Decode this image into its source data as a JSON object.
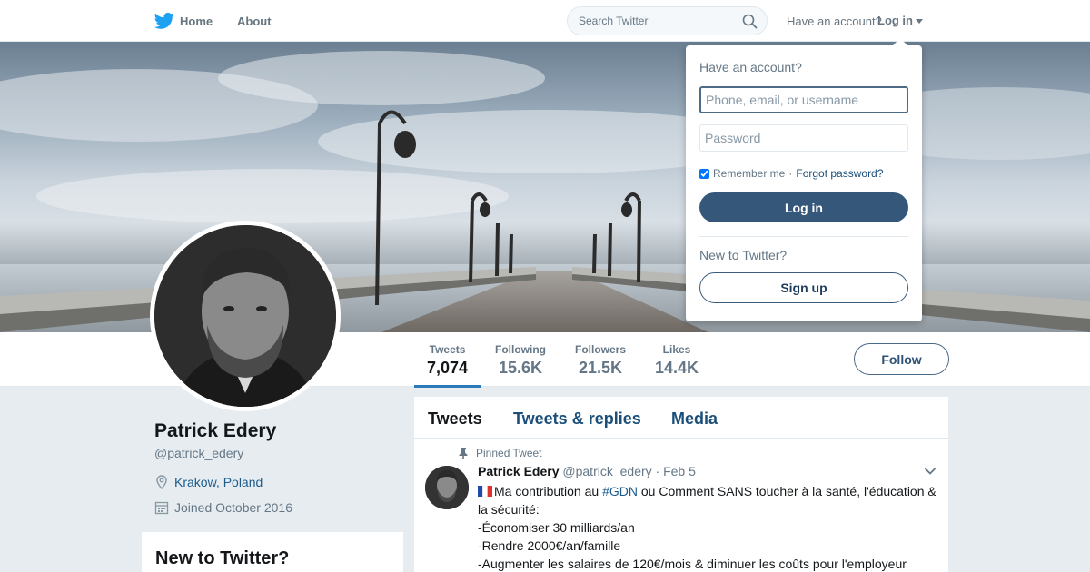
{
  "nav": {
    "home_label": "Home",
    "about_label": "About",
    "search_placeholder": "Search Twitter",
    "have_account": "Have an account?",
    "login_label": "Log in"
  },
  "colors": {
    "accent": "#2b7bb9",
    "link": "#1b5c8c",
    "login_button": "#35587a"
  },
  "profile": {
    "name": "Patrick Edery",
    "handle": "@patrick_edery",
    "location": "Krakow, Poland",
    "joined": "Joined October 2016"
  },
  "stats": [
    {
      "label": "Tweets",
      "value": "7,074",
      "active": true
    },
    {
      "label": "Following",
      "value": "15.6K"
    },
    {
      "label": "Followers",
      "value": "21.5K"
    },
    {
      "label": "Likes",
      "value": "14.4K"
    }
  ],
  "follow_label": "Follow",
  "sidebar": {
    "new_to_twitter_title": "New to Twitter?"
  },
  "timeline": {
    "tabs": [
      "Tweets",
      "Tweets & replies",
      "Media"
    ],
    "pinned_label": "Pinned Tweet",
    "tweet": {
      "author_name": "Patrick Edery",
      "author_handle": "@patrick_edery",
      "date": "· Feb 5",
      "text_before_hashtag": "Ma contribution au ",
      "hashtag": "#GDN",
      "text_after_hashtag": " ou Comment SANS toucher à la santé, l'éducation & la sécurité:",
      "lines": [
        "-Économiser 30 milliards/an",
        "-Rendre 2000€/an/famille",
        "-Augmenter les salaires de 120€/mois & diminuer les coûts pour l'employeur"
      ]
    }
  },
  "login_dropdown": {
    "title": "Have an account?",
    "username_placeholder": "Phone, email, or username",
    "password_placeholder": "Password",
    "remember_me": "Remember me",
    "separator": "·",
    "forgot_password": "Forgot password?",
    "login_button": "Log in",
    "new_to_twitter": "New to Twitter?",
    "signup_button": "Sign up"
  }
}
